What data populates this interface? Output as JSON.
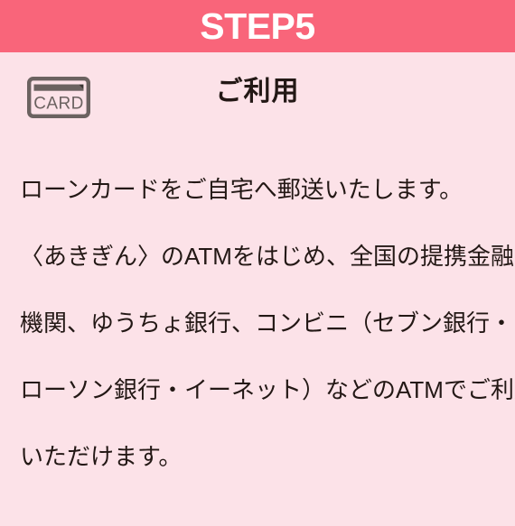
{
  "header": {
    "step_label": "STEP5",
    "background_color": "#f9657a",
    "text_color": "#ffffff"
  },
  "page": {
    "background_color": "#fce2e8",
    "text_color": "#231815"
  },
  "section": {
    "icon_name": "card-icon",
    "icon_label": "CARD",
    "icon_color": "#6b6260",
    "heading": "ご利用"
  },
  "body": {
    "full_text": "ローンカードをご自宅へ郵送いたします。〈あきぎん〉のATMをはじめ、全国の提携金融機関、ゆうちょ銀行、コンビニ（セブン銀行・ローソン銀行・イーネット）などのATMでご利用いただけます。",
    "lines": [
      "ローンカードをご自宅へ郵送いたします。",
      "〈あきぎん〉のATMをはじめ、全国の提携金融",
      "機関、ゆうちょ銀行、コンビニ（セブン銀行・",
      "ローソン銀行・イーネット）などのATMでご利用",
      "いただけます。"
    ]
  }
}
